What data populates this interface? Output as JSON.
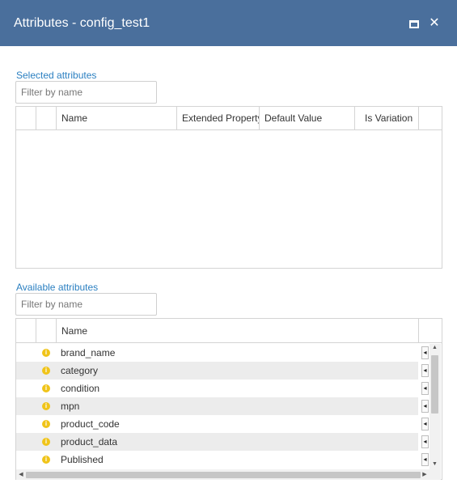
{
  "window": {
    "title": "Attributes - config_test1"
  },
  "selected": {
    "label": "Selected attributes",
    "filter_placeholder": "Filter by name",
    "columns": [
      "Name",
      "Extended Property",
      "Default Value",
      "Is Variation"
    ]
  },
  "available": {
    "label": "Available attributes",
    "filter_placeholder": "Filter by name",
    "columns": [
      "Name"
    ],
    "rows": [
      {
        "name": "brand_name"
      },
      {
        "name": "category"
      },
      {
        "name": "condition"
      },
      {
        "name": "mpn"
      },
      {
        "name": "product_code"
      },
      {
        "name": "product_data"
      },
      {
        "name": "Published"
      }
    ]
  },
  "icons": {
    "maximize": "maximize-icon",
    "close": "close-icon",
    "info": "info-icon",
    "row_action": "add-arrow-icon"
  },
  "colors": {
    "titlebar": "#4a6f9c",
    "link": "#2a7fc1",
    "info": "#f0c419"
  }
}
